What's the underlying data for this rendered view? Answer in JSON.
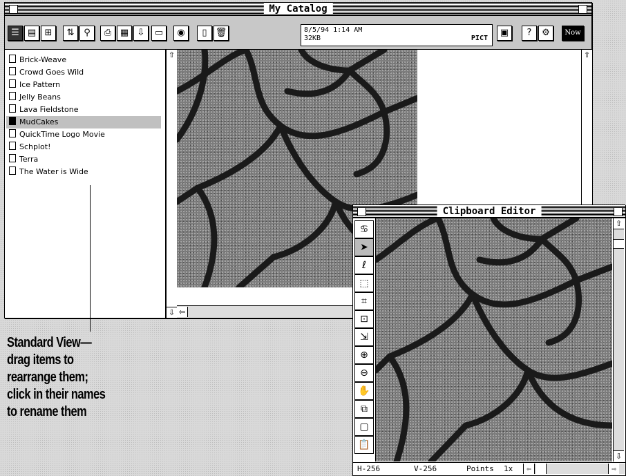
{
  "catalog": {
    "title": "My Catalog",
    "info_datetime": "8/5/94  1:14 AM",
    "info_size": "32KB",
    "info_type": "PICT",
    "now_button": "Now",
    "items": [
      {
        "label": "Brick-Weave",
        "selected": false
      },
      {
        "label": "Crowd Goes Wild",
        "selected": false
      },
      {
        "label": "Ice Pattern",
        "selected": false
      },
      {
        "label": "Jelly Beans",
        "selected": false
      },
      {
        "label": "Lava Fieldstone",
        "selected": false
      },
      {
        "label": "MudCakes",
        "selected": true
      },
      {
        "label": "QuickTime Logo Movie",
        "selected": false
      },
      {
        "label": "Schplot!",
        "selected": false
      },
      {
        "label": "Terra",
        "selected": false
      },
      {
        "label": "The Water is Wide",
        "selected": false
      }
    ]
  },
  "clipboard": {
    "title": "Clipboard Editor",
    "status_h": "H-256",
    "status_v": "V-256",
    "status_units": "Points",
    "status_zoom": "1x"
  },
  "caption": {
    "line1": "Standard View—",
    "line2": "drag items to",
    "line3": "rearrange them;",
    "line4": "click in their names",
    "line5": "to rename them"
  },
  "icons": [
    "standard-view-icon",
    "list-view-icon",
    "thumbnail-view-icon",
    "sort-icon",
    "find-icon",
    "print-icon",
    "print-all-icon",
    "import-icon",
    "export-icon",
    "info-icon",
    "paste-icon",
    "trash-icon",
    "picture-icon",
    "help-icon",
    "tools-icon",
    "pointer-icon",
    "lasso-icon",
    "marquee-icon",
    "polygon-icon",
    "resize-icon",
    "crop-icon",
    "zoom-in-icon",
    "zoom-out-icon",
    "hand-icon"
  ]
}
